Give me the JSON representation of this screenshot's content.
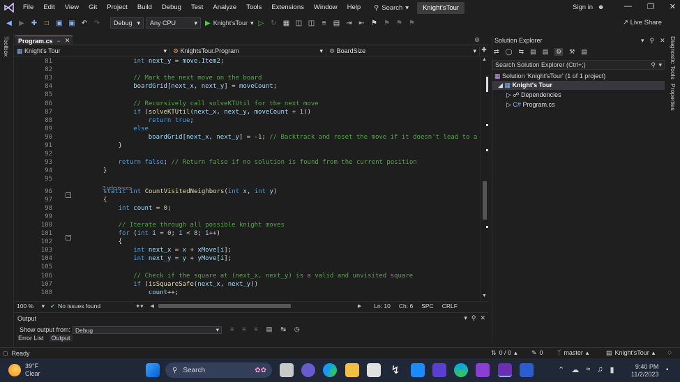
{
  "menubar": {
    "items": [
      "File",
      "Edit",
      "View",
      "Git",
      "Project",
      "Build",
      "Debug",
      "Test",
      "Analyze",
      "Tools",
      "Extensions",
      "Window",
      "Help"
    ],
    "search_label": "Search",
    "solution_name": "Knight'sTour",
    "signin_label": "Sign in"
  },
  "toolbar": {
    "config": "Debug",
    "platform": "Any CPU",
    "run_target": "Knight'sTour",
    "liveshare_label": "Live Share"
  },
  "left_rail": {
    "label": "Toolbox"
  },
  "right_rail": {
    "labels": [
      "Diagnostic Tools",
      "Properties"
    ]
  },
  "editor": {
    "tab_label": "Program.cs",
    "nav": {
      "project": "Knight's Tour",
      "class": "KnightsTour.Program",
      "member": "BoardSize"
    },
    "refs_hint": "3 references",
    "lines": [
      {
        "n": "81",
        "segs": [
          [
            "kw",
            "int "
          ],
          [
            "id",
            "next_y"
          ],
          [
            "pl",
            " = "
          ],
          [
            "id",
            "move"
          ],
          [
            "pl",
            "."
          ],
          [
            "id",
            "Item2"
          ],
          [
            "pl",
            ";"
          ]
        ],
        "indent": 4
      },
      {
        "n": "82",
        "segs": [],
        "indent": 0
      },
      {
        "n": "83",
        "segs": [
          [
            "cm",
            "// Mark the next move on the board"
          ]
        ],
        "indent": 4
      },
      {
        "n": "84",
        "segs": [
          [
            "id",
            "boardGrid"
          ],
          [
            "pl",
            "["
          ],
          [
            "id",
            "next_x"
          ],
          [
            "pl",
            ", "
          ],
          [
            "id",
            "next_y"
          ],
          [
            "pl",
            "] = "
          ],
          [
            "id",
            "moveCount"
          ],
          [
            "pl",
            ";"
          ]
        ],
        "indent": 4
      },
      {
        "n": "85",
        "segs": [],
        "indent": 0
      },
      {
        "n": "86",
        "segs": [
          [
            "cm",
            "// Recursively call solveKTUtil for the next move"
          ]
        ],
        "indent": 4
      },
      {
        "n": "87",
        "segs": [
          [
            "kw",
            "if "
          ],
          [
            "pl",
            "("
          ],
          [
            "fn",
            "solveKTUtil"
          ],
          [
            "pl",
            "("
          ],
          [
            "id",
            "next_x"
          ],
          [
            "pl",
            ", "
          ],
          [
            "id",
            "next_y"
          ],
          [
            "pl",
            ", "
          ],
          [
            "id",
            "moveCount"
          ],
          [
            "pl",
            " + "
          ],
          [
            "num",
            "1"
          ],
          [
            "pl",
            "))"
          ]
        ],
        "indent": 4
      },
      {
        "n": "88",
        "segs": [
          [
            "kw",
            "return "
          ],
          [
            "kw",
            "true"
          ],
          [
            "pl",
            ";"
          ]
        ],
        "indent": 6
      },
      {
        "n": "89",
        "segs": [
          [
            "kw",
            "else"
          ]
        ],
        "indent": 4
      },
      {
        "n": "90",
        "segs": [
          [
            "id",
            "boardGrid"
          ],
          [
            "pl",
            "["
          ],
          [
            "id",
            "next_x"
          ],
          [
            "pl",
            ", "
          ],
          [
            "id",
            "next_y"
          ],
          [
            "pl",
            "] = -"
          ],
          [
            "num",
            "1"
          ],
          [
            "pl",
            "; "
          ],
          [
            "cm",
            "// Backtrack and reset the move if it doesn't lead to a"
          ]
        ],
        "indent": 6
      },
      {
        "n": "91",
        "segs": [
          [
            "pl",
            "}"
          ]
        ],
        "indent": 2
      },
      {
        "n": "92",
        "segs": [],
        "indent": 0
      },
      {
        "n": "93",
        "segs": [
          [
            "kw",
            "return "
          ],
          [
            "kw",
            "false"
          ],
          [
            "pl",
            "; "
          ],
          [
            "cm",
            "// Return false if no solution is found from the current position"
          ]
        ],
        "indent": 2
      },
      {
        "n": "94",
        "segs": [
          [
            "pl",
            "}"
          ]
        ],
        "indent": 0
      },
      {
        "n": "95",
        "segs": [],
        "indent": 0
      },
      {
        "n": "96",
        "segs": [
          [
            "kw",
            "static "
          ],
          [
            "kw",
            "int "
          ],
          [
            "fn",
            "CountVisitedNeighbors"
          ],
          [
            "pl",
            "("
          ],
          [
            "kw",
            "int "
          ],
          [
            "id",
            "x"
          ],
          [
            "pl",
            ", "
          ],
          [
            "kw",
            "int "
          ],
          [
            "id",
            "y"
          ],
          [
            "pl",
            ")"
          ]
        ],
        "indent": 0
      },
      {
        "n": "97",
        "segs": [
          [
            "pl",
            "{"
          ]
        ],
        "indent": 0
      },
      {
        "n": "98",
        "segs": [
          [
            "kw",
            "int "
          ],
          [
            "id",
            "count"
          ],
          [
            "pl",
            " = "
          ],
          [
            "num",
            "0"
          ],
          [
            "pl",
            ";"
          ]
        ],
        "indent": 2
      },
      {
        "n": "99",
        "segs": [],
        "indent": 0
      },
      {
        "n": "100",
        "segs": [
          [
            "cm",
            "// Iterate through all possible knight moves"
          ]
        ],
        "indent": 2
      },
      {
        "n": "101",
        "segs": [
          [
            "kw",
            "for "
          ],
          [
            "pl",
            "("
          ],
          [
            "kw",
            "int "
          ],
          [
            "id",
            "i"
          ],
          [
            "pl",
            " = "
          ],
          [
            "num",
            "0"
          ],
          [
            "pl",
            "; "
          ],
          [
            "id",
            "i"
          ],
          [
            "pl",
            " < "
          ],
          [
            "num",
            "8"
          ],
          [
            "pl",
            "; "
          ],
          [
            "id",
            "i"
          ],
          [
            "pl",
            "++)"
          ]
        ],
        "indent": 2
      },
      {
        "n": "102",
        "segs": [
          [
            "pl",
            "{"
          ]
        ],
        "indent": 2
      },
      {
        "n": "103",
        "segs": [
          [
            "kw",
            "int "
          ],
          [
            "id",
            "next_x"
          ],
          [
            "pl",
            " = "
          ],
          [
            "id",
            "x"
          ],
          [
            "pl",
            " + "
          ],
          [
            "id",
            "xMove"
          ],
          [
            "pl",
            "["
          ],
          [
            "id",
            "i"
          ],
          [
            "pl",
            "];"
          ]
        ],
        "indent": 4
      },
      {
        "n": "104",
        "segs": [
          [
            "kw",
            "int "
          ],
          [
            "id",
            "next_y"
          ],
          [
            "pl",
            " = "
          ],
          [
            "id",
            "y"
          ],
          [
            "pl",
            " + "
          ],
          [
            "id",
            "yMove"
          ],
          [
            "pl",
            "["
          ],
          [
            "id",
            "i"
          ],
          [
            "pl",
            "];"
          ]
        ],
        "indent": 4
      },
      {
        "n": "105",
        "segs": [],
        "indent": 0
      },
      {
        "n": "106",
        "segs": [
          [
            "cm",
            "// Check if the square at (next_x, next_y) is a valid and unvisited square"
          ]
        ],
        "indent": 4
      },
      {
        "n": "107",
        "segs": [
          [
            "kw",
            "if "
          ],
          [
            "pl",
            "("
          ],
          [
            "fn",
            "isSquareSafe"
          ],
          [
            "pl",
            "("
          ],
          [
            "id",
            "next_x"
          ],
          [
            "pl",
            ", "
          ],
          [
            "id",
            "next_y"
          ],
          [
            "pl",
            "))"
          ]
        ],
        "indent": 4
      },
      {
        "n": "108",
        "segs": [
          [
            "id",
            "count"
          ],
          [
            "pl",
            "++;"
          ]
        ],
        "indent": 6
      }
    ],
    "status": {
      "zoom": "100 %",
      "issues": "No issues found",
      "ln": "Ln: 10",
      "ch": "Ch: 6",
      "enc": "SPC",
      "eol": "CRLF"
    }
  },
  "output": {
    "title": "Output",
    "show_from_label": "Show output from:",
    "source": "Debug",
    "tabs": [
      "Error List",
      "Output"
    ]
  },
  "solution_explorer": {
    "title": "Solution Explorer",
    "search_placeholder": "Search Solution Explorer (Ctrl+;)",
    "solution_label": "Solution 'Knight'sTour' (1 of 1 project)",
    "project": "Knight's Tour",
    "dependencies": "Dependencies",
    "file": "Program.cs"
  },
  "statusbar": {
    "ready": "Ready",
    "changes": "0 / 0",
    "edits": "0",
    "branch": "master",
    "repo": "Knight'sTour"
  },
  "taskbar": {
    "weather_temp": "39°F",
    "weather_desc": "Clear",
    "search_label": "Search",
    "time": "9:40 PM",
    "date": "11/2/2023"
  }
}
